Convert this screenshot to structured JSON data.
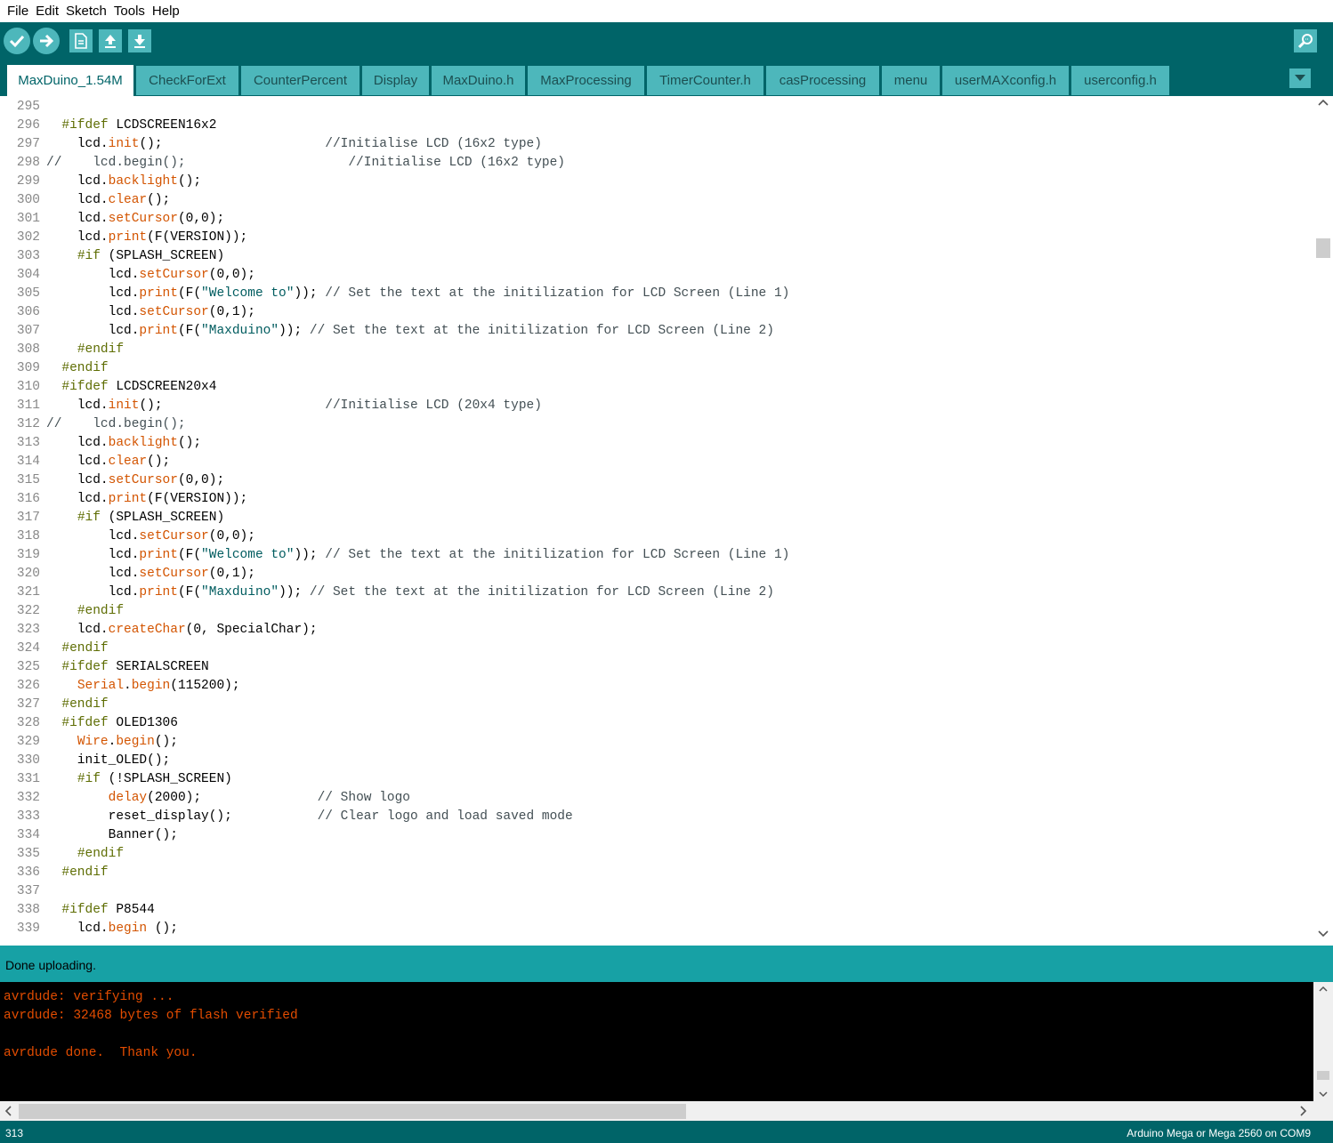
{
  "menu": [
    "File",
    "Edit",
    "Sketch",
    "Tools",
    "Help"
  ],
  "toolbar": {
    "verify": "verify-icon",
    "upload": "upload-arrow-icon",
    "new": "new-file-icon",
    "open": "open-icon",
    "save": "save-icon",
    "serial_monitor": "serial-monitor-icon"
  },
  "tabs": [
    "MaxDuino_1.54M",
    "CheckForExt",
    "CounterPercent",
    "Display",
    "MaxDuino.h",
    "MaxProcessing",
    "TimerCounter.h",
    "casProcessing",
    "menu",
    "userMAXconfig.h",
    "userconfig.h"
  ],
  "active_tab": "MaxDuino_1.54M",
  "colors": {
    "toolbar_bg": "#006468",
    "tab_bg": "#4db7bb",
    "status_bg": "#17a1a5",
    "keyword": "#D35400",
    "preprocessor": "#5E6D03",
    "string": "#005C5F",
    "console_text": "#e34c00"
  },
  "code_lines": [
    {
      "n": "295",
      "segs": []
    },
    {
      "n": "296",
      "segs": [
        [
          "  ",
          ""
        ],
        [
          "#ifdef",
          "pp"
        ],
        [
          " LCDSCREEN16x2",
          ""
        ]
      ]
    },
    {
      "n": "297",
      "segs": [
        [
          "    lcd.",
          ""
        ],
        [
          "init",
          "kw"
        ],
        [
          "();                     ",
          ""
        ],
        [
          "//Initialise LCD (16x2 type)",
          "cm"
        ]
      ]
    },
    {
      "n": "298",
      "segs": [
        [
          "//    lcd.begin();                     //Initialise LCD (16x2 type)",
          "cm"
        ]
      ]
    },
    {
      "n": "299",
      "segs": [
        [
          "    lcd.",
          ""
        ],
        [
          "backlight",
          "kw"
        ],
        [
          "();",
          ""
        ]
      ]
    },
    {
      "n": "300",
      "segs": [
        [
          "    lcd.",
          ""
        ],
        [
          "clear",
          "kw"
        ],
        [
          "();",
          ""
        ]
      ]
    },
    {
      "n": "301",
      "segs": [
        [
          "    lcd.",
          ""
        ],
        [
          "setCursor",
          "kw"
        ],
        [
          "(0,0);",
          ""
        ]
      ]
    },
    {
      "n": "302",
      "segs": [
        [
          "    lcd.",
          ""
        ],
        [
          "print",
          "kw"
        ],
        [
          "(F(VERSION));",
          ""
        ]
      ]
    },
    {
      "n": "303",
      "segs": [
        [
          "    ",
          ""
        ],
        [
          "#if",
          "pp"
        ],
        [
          " (SPLASH_SCREEN)",
          ""
        ]
      ]
    },
    {
      "n": "304",
      "segs": [
        [
          "        lcd.",
          ""
        ],
        [
          "setCursor",
          "kw"
        ],
        [
          "(0,0);",
          ""
        ]
      ]
    },
    {
      "n": "305",
      "segs": [
        [
          "        lcd.",
          ""
        ],
        [
          "print",
          "kw"
        ],
        [
          "(F(",
          ""
        ],
        [
          "\"Welcome to\"",
          "str"
        ],
        [
          ")); ",
          ""
        ],
        [
          "// Set the text at the initilization for LCD Screen (Line 1)",
          "cm"
        ]
      ]
    },
    {
      "n": "306",
      "segs": [
        [
          "        lcd.",
          ""
        ],
        [
          "setCursor",
          "kw"
        ],
        [
          "(0,1);",
          ""
        ]
      ]
    },
    {
      "n": "307",
      "segs": [
        [
          "        lcd.",
          ""
        ],
        [
          "print",
          "kw"
        ],
        [
          "(F(",
          ""
        ],
        [
          "\"Maxduino\"",
          "str"
        ],
        [
          ")); ",
          ""
        ],
        [
          "// Set the text at the initilization for LCD Screen (Line 2)",
          "cm"
        ]
      ]
    },
    {
      "n": "308",
      "segs": [
        [
          "    ",
          ""
        ],
        [
          "#endif",
          "pp"
        ]
      ]
    },
    {
      "n": "309",
      "segs": [
        [
          "  ",
          ""
        ],
        [
          "#endif",
          "pp"
        ]
      ]
    },
    {
      "n": "310",
      "segs": [
        [
          "  ",
          ""
        ],
        [
          "#ifdef",
          "pp"
        ],
        [
          " LCDSCREEN20x4",
          ""
        ]
      ]
    },
    {
      "n": "311",
      "segs": [
        [
          "    lcd.",
          ""
        ],
        [
          "init",
          "kw"
        ],
        [
          "();                     ",
          ""
        ],
        [
          "//Initialise LCD (20x4 type)",
          "cm"
        ]
      ]
    },
    {
      "n": "312",
      "segs": [
        [
          "//    lcd.begin();",
          "cm"
        ]
      ]
    },
    {
      "n": "313",
      "segs": [
        [
          "    lcd.",
          ""
        ],
        [
          "backlight",
          "kw"
        ],
        [
          "();",
          ""
        ]
      ]
    },
    {
      "n": "314",
      "segs": [
        [
          "    lcd.",
          ""
        ],
        [
          "clear",
          "kw"
        ],
        [
          "();",
          ""
        ]
      ]
    },
    {
      "n": "315",
      "segs": [
        [
          "    lcd.",
          ""
        ],
        [
          "setCursor",
          "kw"
        ],
        [
          "(0,0);",
          ""
        ]
      ]
    },
    {
      "n": "316",
      "segs": [
        [
          "    lcd.",
          ""
        ],
        [
          "print",
          "kw"
        ],
        [
          "(F(VERSION));",
          ""
        ]
      ]
    },
    {
      "n": "317",
      "segs": [
        [
          "    ",
          ""
        ],
        [
          "#if",
          "pp"
        ],
        [
          " (SPLASH_SCREEN)",
          ""
        ]
      ]
    },
    {
      "n": "318",
      "segs": [
        [
          "        lcd.",
          ""
        ],
        [
          "setCursor",
          "kw"
        ],
        [
          "(0,0);",
          ""
        ]
      ]
    },
    {
      "n": "319",
      "segs": [
        [
          "        lcd.",
          ""
        ],
        [
          "print",
          "kw"
        ],
        [
          "(F(",
          ""
        ],
        [
          "\"Welcome to\"",
          "str"
        ],
        [
          ")); ",
          ""
        ],
        [
          "// Set the text at the initilization for LCD Screen (Line 1)",
          "cm"
        ]
      ]
    },
    {
      "n": "320",
      "segs": [
        [
          "        lcd.",
          ""
        ],
        [
          "setCursor",
          "kw"
        ],
        [
          "(0,1);",
          ""
        ]
      ]
    },
    {
      "n": "321",
      "segs": [
        [
          "        lcd.",
          ""
        ],
        [
          "print",
          "kw"
        ],
        [
          "(F(",
          ""
        ],
        [
          "\"Maxduino\"",
          "str"
        ],
        [
          ")); ",
          ""
        ],
        [
          "// Set the text at the initilization for LCD Screen (Line 2)",
          "cm"
        ]
      ]
    },
    {
      "n": "322",
      "segs": [
        [
          "    ",
          ""
        ],
        [
          "#endif",
          "pp"
        ]
      ]
    },
    {
      "n": "323",
      "segs": [
        [
          "    lcd.",
          ""
        ],
        [
          "createChar",
          "kw"
        ],
        [
          "(0, SpecialChar);",
          ""
        ]
      ]
    },
    {
      "n": "324",
      "segs": [
        [
          "  ",
          ""
        ],
        [
          "#endif",
          "pp"
        ]
      ]
    },
    {
      "n": "325",
      "segs": [
        [
          "  ",
          ""
        ],
        [
          "#ifdef",
          "pp"
        ],
        [
          " SERIALSCREEN",
          ""
        ]
      ]
    },
    {
      "n": "326",
      "segs": [
        [
          "    ",
          ""
        ],
        [
          "Serial",
          "kw"
        ],
        [
          ".",
          ""
        ],
        [
          "begin",
          "kw"
        ],
        [
          "(115200);",
          ""
        ]
      ]
    },
    {
      "n": "327",
      "segs": [
        [
          "  ",
          ""
        ],
        [
          "#endif",
          "pp"
        ]
      ]
    },
    {
      "n": "328",
      "segs": [
        [
          "  ",
          ""
        ],
        [
          "#ifdef",
          "pp"
        ],
        [
          " OLED1306",
          ""
        ]
      ]
    },
    {
      "n": "329",
      "segs": [
        [
          "    ",
          ""
        ],
        [
          "Wire",
          "kw"
        ],
        [
          ".",
          ""
        ],
        [
          "begin",
          "kw"
        ],
        [
          "();",
          ""
        ]
      ]
    },
    {
      "n": "330",
      "segs": [
        [
          "    init_OLED();",
          ""
        ]
      ]
    },
    {
      "n": "331",
      "segs": [
        [
          "    ",
          ""
        ],
        [
          "#if",
          "pp"
        ],
        [
          " (!SPLASH_SCREEN)",
          ""
        ]
      ]
    },
    {
      "n": "332",
      "segs": [
        [
          "        ",
          ""
        ],
        [
          "delay",
          "kw"
        ],
        [
          "(2000);               ",
          ""
        ],
        [
          "// Show logo",
          "cm"
        ]
      ]
    },
    {
      "n": "333",
      "segs": [
        [
          "        reset_display();           ",
          ""
        ],
        [
          "// Clear logo and load saved mode",
          "cm"
        ]
      ]
    },
    {
      "n": "334",
      "segs": [
        [
          "        Banner();",
          ""
        ]
      ]
    },
    {
      "n": "335",
      "segs": [
        [
          "    ",
          ""
        ],
        [
          "#endif",
          "pp"
        ]
      ]
    },
    {
      "n": "336",
      "segs": [
        [
          "  ",
          ""
        ],
        [
          "#endif",
          "pp"
        ]
      ]
    },
    {
      "n": "337",
      "segs": []
    },
    {
      "n": "338",
      "segs": [
        [
          "  ",
          ""
        ],
        [
          "#ifdef",
          "pp"
        ],
        [
          " P8544",
          ""
        ]
      ]
    },
    {
      "n": "339",
      "segs": [
        [
          "    lcd.",
          ""
        ],
        [
          "begin",
          "kw"
        ],
        [
          " ();",
          ""
        ]
      ]
    }
  ],
  "status_message": "Done uploading.",
  "console_lines": [
    "avrdude: verifying ...",
    "avrdude: 32468 bytes of flash verified",
    "",
    "avrdude done.  Thank you."
  ],
  "footer": {
    "line_number": "313",
    "board": "Arduino Mega or Mega 2560 on COM9"
  }
}
